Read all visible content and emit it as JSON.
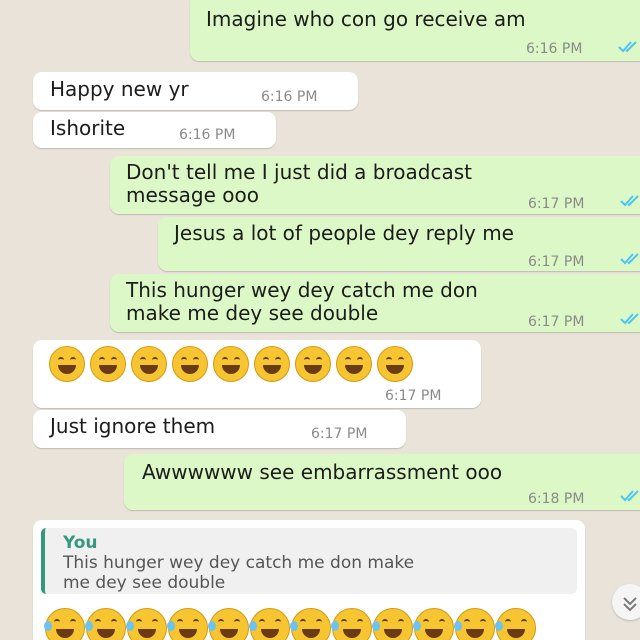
{
  "messages": [
    {
      "text": "Imagine who con go receive am",
      "time": "6:16 PM"
    },
    {
      "text": "Happy new yr",
      "time": "6:16 PM"
    },
    {
      "text": "Ishorite",
      "time": "6:16 PM"
    },
    {
      "text": "Don't tell me I just did a broadcast\nmessage ooo",
      "time": "6:17 PM"
    },
    {
      "text": "Jesus a lot of people dey reply me",
      "time": "6:17 PM"
    },
    {
      "text": "This hunger wey dey catch me don\nmake me dey see double",
      "time": "6:17 PM"
    },
    {
      "emoji_count": 9,
      "emoji": "grinning-face",
      "time": "6:17 PM"
    },
    {
      "text": "Just ignore them",
      "time": "6:17 PM"
    },
    {
      "text": "Awwwwww see embarrassment ooo",
      "time": "6:18 PM"
    }
  ],
  "reply": {
    "quote_author": "You",
    "quote_text": "This hunger wey dey catch me don make\nme dey see double",
    "emoji": "face-with-tears-of-joy",
    "emoji_count": 12
  },
  "colors": {
    "outgoing_bubble": "#dcf8c6",
    "incoming_bubble": "#ffffff",
    "background": "#e9e3da",
    "read_ticks": "#4fc3f7",
    "quote_accent": "#35987d"
  },
  "icons": {
    "read_receipt": "double-check-icon",
    "scroll_down": "chevron-down-icon"
  }
}
